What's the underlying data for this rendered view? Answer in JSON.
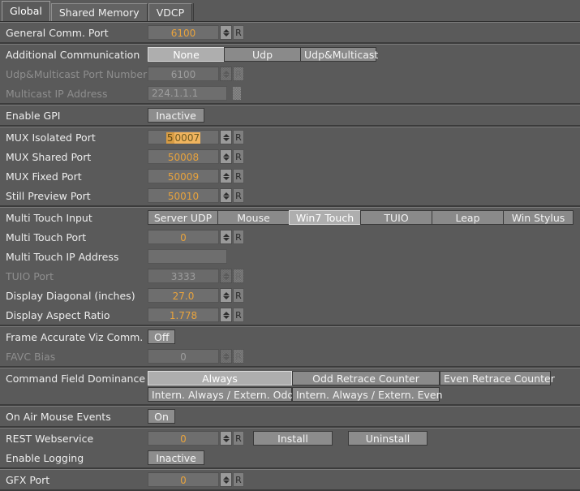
{
  "tabs": [
    {
      "label": "Global",
      "active": true
    },
    {
      "label": "Shared Memory",
      "active": false
    },
    {
      "label": "VDCP",
      "active": false
    }
  ],
  "rows": {
    "general_comm_port": {
      "label": "General Comm. Port",
      "value": "6100",
      "reset": "R"
    },
    "additional_communication": {
      "label": "Additional Communication",
      "options": [
        "None",
        "Udp",
        "Udp&Multicast"
      ],
      "selected": "None"
    },
    "udp_multicast_port_number": {
      "label": "Udp&Multicast Port Number",
      "value": "6100",
      "reset": "R"
    },
    "multicast_ip_address": {
      "label": "Multicast IP Address",
      "value": "224.1.1.1"
    },
    "enable_gpi": {
      "label": "Enable GPI",
      "value": "Inactive"
    },
    "mux_isolated_port": {
      "label": "MUX Isolated Port",
      "value": "50007",
      "caret": "5",
      "selection": "0007",
      "reset": "R"
    },
    "mux_shared_port": {
      "label": "MUX Shared Port",
      "value": "50008",
      "reset": "R"
    },
    "mux_fixed_port": {
      "label": "MUX Fixed Port",
      "value": "50009",
      "reset": "R"
    },
    "still_preview_port": {
      "label": "Still Preview Port",
      "value": "50010",
      "reset": "R"
    },
    "multi_touch_input": {
      "label": "Multi Touch Input",
      "options": [
        "Server UDP",
        "Mouse",
        "Win7 Touch",
        "TUIO",
        "Leap",
        "Win Stylus"
      ],
      "selected": "Win7 Touch"
    },
    "multi_touch_port": {
      "label": "Multi Touch Port",
      "value": "0",
      "reset": "R"
    },
    "multi_touch_ip_address": {
      "label": "Multi Touch IP Address",
      "value": ""
    },
    "tuio_port": {
      "label": "TUIO Port",
      "value": "3333",
      "reset": "R"
    },
    "display_diagonal": {
      "label": "Display Diagonal (inches)",
      "value": "27.0",
      "reset": "R"
    },
    "display_aspect_ratio": {
      "label": "Display Aspect Ratio",
      "value": "1.778",
      "reset": "R"
    },
    "frame_accurate_viz_comm": {
      "label": "Frame Accurate Viz Comm.",
      "value": "Off"
    },
    "favc_bias": {
      "label": "FAVC Bias",
      "value": "0",
      "reset": "R"
    },
    "command_field_dominance": {
      "label": "Command Field Dominance",
      "options_row1": [
        "Always",
        "Odd Retrace Counter",
        "Even Retrace Counter"
      ],
      "options_row2": [
        "Intern. Always / Extern. Odd",
        "Intern. Always / Extern. Even"
      ],
      "selected": "Always"
    },
    "on_air_mouse_events": {
      "label": "On Air Mouse Events",
      "value": "On"
    },
    "rest_webservice": {
      "label": "REST Webservice",
      "value": "0",
      "reset": "R",
      "install_label": "Install",
      "uninstall_label": "Uninstall"
    },
    "enable_logging": {
      "label": "Enable Logging",
      "value": "Inactive"
    },
    "gfx_port": {
      "label": "GFX Port",
      "value": "0",
      "reset": "R"
    }
  },
  "colors": {
    "background": "#5a5a5a",
    "field_value": "#e8a33d",
    "selection": "#f0b45e",
    "button": "#8a8a8a",
    "button_selected": "#aeaeae"
  }
}
